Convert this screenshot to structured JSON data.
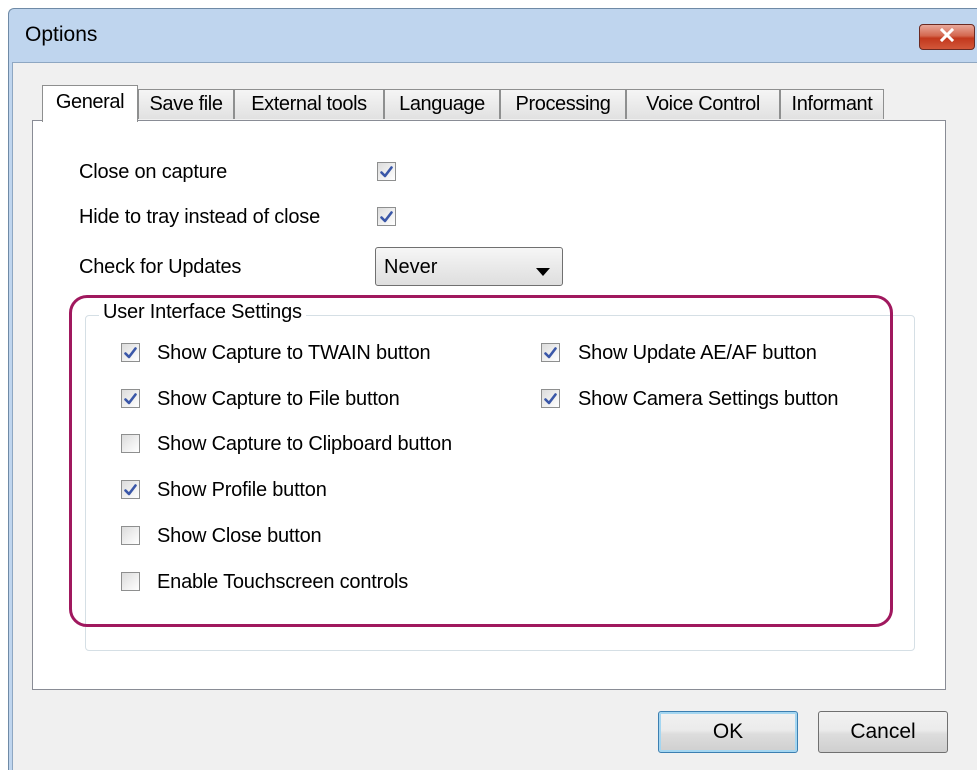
{
  "window": {
    "title": "Options"
  },
  "tabs": [
    {
      "label": "General",
      "active": true
    },
    {
      "label": "Save file"
    },
    {
      "label": "External tools"
    },
    {
      "label": "Language"
    },
    {
      "label": "Processing"
    },
    {
      "label": "Voice Control"
    },
    {
      "label": "Informant"
    }
  ],
  "general": {
    "close_on_capture": {
      "label": "Close on capture",
      "checked": true
    },
    "hide_to_tray": {
      "label": "Hide to tray instead of close",
      "checked": true
    },
    "check_updates": {
      "label": "Check for Updates",
      "value": "Never"
    }
  },
  "ui_settings": {
    "legend": "User Interface Settings",
    "items": [
      {
        "label": "Show Capture to TWAIN button",
        "checked": true
      },
      {
        "label": "Show Capture to File button",
        "checked": true
      },
      {
        "label": "Show Capture to Clipboard button",
        "checked": false
      },
      {
        "label": "Show Profile button",
        "checked": true
      },
      {
        "label": "Show Close button",
        "checked": false
      },
      {
        "label": "Enable Touchscreen controls",
        "checked": false
      },
      {
        "label": "Show Update AE/AF button",
        "checked": true
      },
      {
        "label": "Show Camera Settings button",
        "checked": true
      }
    ]
  },
  "buttons": {
    "ok": "OK",
    "cancel": "Cancel"
  },
  "colors": {
    "highlight": "#a0185e",
    "check": "#3a57a8",
    "close_button": "#c2381d"
  }
}
